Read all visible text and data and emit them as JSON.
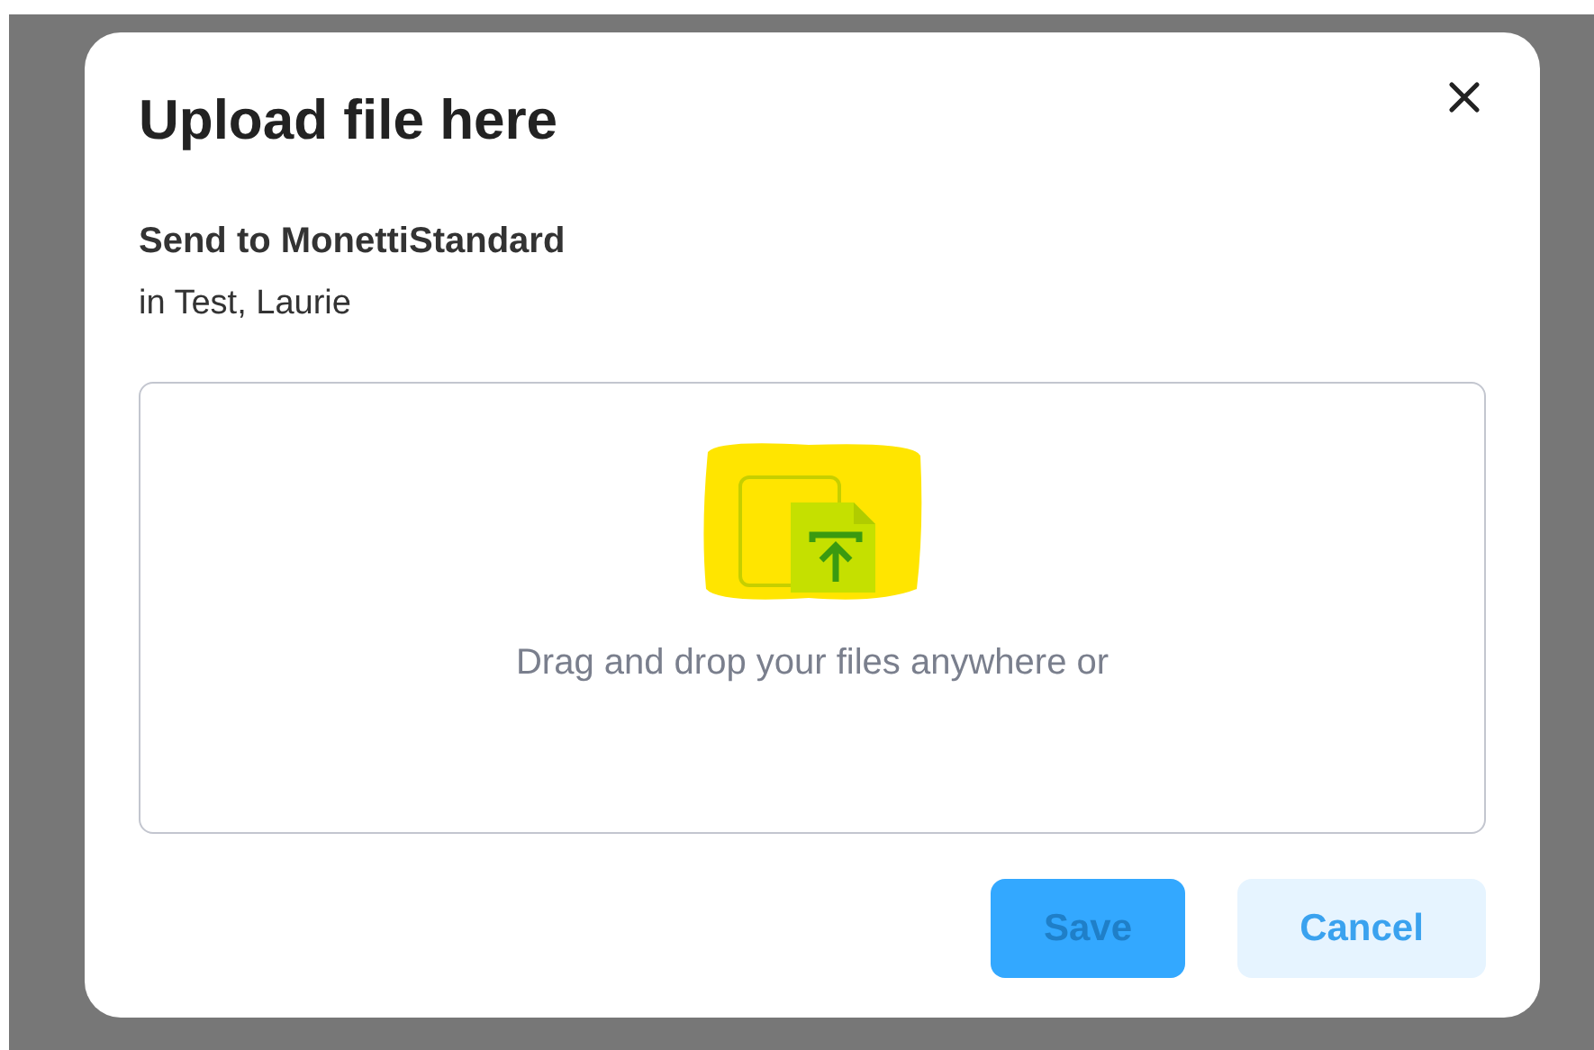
{
  "dialog": {
    "title": "Upload file here",
    "recipient": "Send to MonettiStandard",
    "location": "in Test, Laurie"
  },
  "dropzone": {
    "instruction": "Drag and drop your files anywhere or",
    "highlighted": true
  },
  "buttons": [
    {
      "label": "Save",
      "kind": "primary",
      "disabled": true
    },
    {
      "label": "Cancel",
      "kind": "secondary",
      "disabled": false
    }
  ]
}
